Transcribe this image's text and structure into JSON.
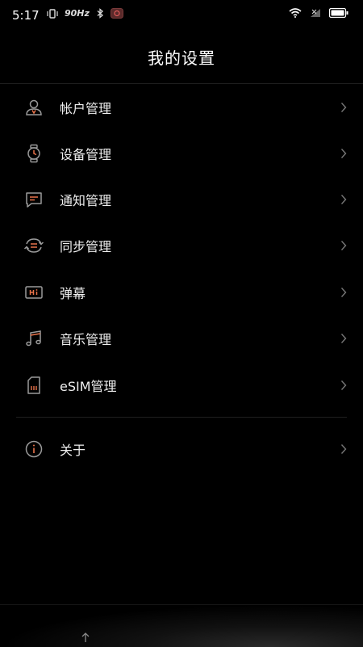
{
  "status_bar": {
    "time": "5:17",
    "refresh": "90Hz",
    "icons": [
      "vibrate-icon",
      "bluetooth-icon",
      "camera-app-icon",
      "wifi-icon",
      "signal-icon",
      "battery-icon"
    ]
  },
  "header": {
    "title": "我的设置"
  },
  "menu": {
    "items": [
      {
        "label": "帐户管理",
        "icon": "account-icon"
      },
      {
        "label": "设备管理",
        "icon": "watch-icon"
      },
      {
        "label": "通知管理",
        "icon": "message-icon"
      },
      {
        "label": "同步管理",
        "icon": "sync-icon"
      },
      {
        "label": "弹幕",
        "icon": "hi-bullet-comment-icon"
      },
      {
        "label": "音乐管理",
        "icon": "music-icon"
      },
      {
        "label": "eSIM管理",
        "icon": "sim-card-icon"
      },
      {
        "label": "关于",
        "icon": "info-icon"
      }
    ]
  },
  "colors": {
    "background": "#000000",
    "accent": "#e8734a",
    "icon_gray": "#9a9a9a"
  }
}
